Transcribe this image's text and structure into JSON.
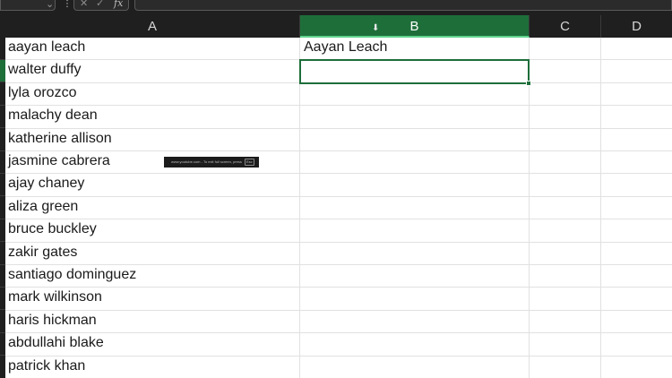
{
  "formula_bar": {
    "namebox_value": "",
    "cancel_icon": "close-icon",
    "enter_icon": "check-icon",
    "fx_label": "fx",
    "formula_value": ""
  },
  "columns": [
    {
      "id": "col-a",
      "label": "A",
      "active": false
    },
    {
      "id": "col-b",
      "label": "B",
      "active": true
    },
    {
      "id": "col-c",
      "label": "C",
      "active": false
    },
    {
      "id": "col-d",
      "label": "D",
      "active": false
    }
  ],
  "column_a": [
    "aayan leach",
    "walter duffy",
    "lyla orozco",
    "malachy dean",
    "katherine allison",
    "jasmine cabrera",
    "ajay chaney",
    "aliza green",
    "bruce buckley",
    "zakir gates",
    "santiago dominguez",
    "mark wilkinson",
    "haris hickman",
    "abdullahi blake",
    "patrick khan"
  ],
  "column_b": [
    "Aayan Leach",
    "",
    "",
    "",
    "",
    "",
    "",
    "",
    "",
    "",
    "",
    "",
    "",
    "",
    ""
  ],
  "active_cell_row_index": 1,
  "overlay": {
    "text": "www.youtube.com - To exit full screen, press",
    "key": "Esc"
  },
  "colors": {
    "accent_green": "#1e6e3a",
    "header_dark": "#1f1f1f",
    "gridline": "#e1e1e1"
  }
}
